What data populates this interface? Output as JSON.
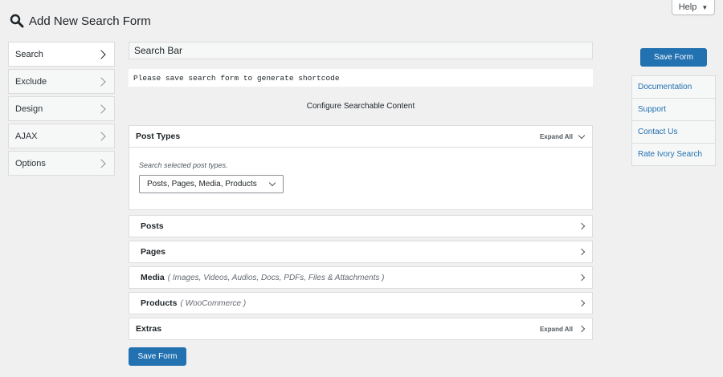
{
  "header": {
    "title": "Add New Search Form",
    "help_label": "Help"
  },
  "tabs": [
    {
      "label": "Search",
      "active": true
    },
    {
      "label": "Exclude",
      "active": false
    },
    {
      "label": "Design",
      "active": false
    },
    {
      "label": "AJAX",
      "active": false
    },
    {
      "label": "Options",
      "active": false
    }
  ],
  "form": {
    "name_value": "Search Bar",
    "shortcode_message": "Please save search form to generate shortcode",
    "configure_heading": "Configure Searchable Content"
  },
  "panels": {
    "post_types": {
      "title": "Post Types",
      "expand_label": "Expand All",
      "hint": "Search selected post types.",
      "selected_value": "Posts, Pages, Media, Products"
    },
    "posts": {
      "title": "Posts"
    },
    "pages": {
      "title": "Pages"
    },
    "media": {
      "title": "Media",
      "subtitle": "( Images, Videos, Audios, Docs, PDFs, Files & Attachments )"
    },
    "products": {
      "title": "Products",
      "subtitle": "( WooCommerce )"
    },
    "extras": {
      "title": "Extras",
      "expand_label": "Expand All"
    }
  },
  "save_label": "Save Form",
  "sidebar_links": [
    "Documentation",
    "Support",
    "Contact Us",
    "Rate Ivory Search"
  ],
  "colors": {
    "accent": "#2271b1",
    "background": "#f0f0f1"
  }
}
